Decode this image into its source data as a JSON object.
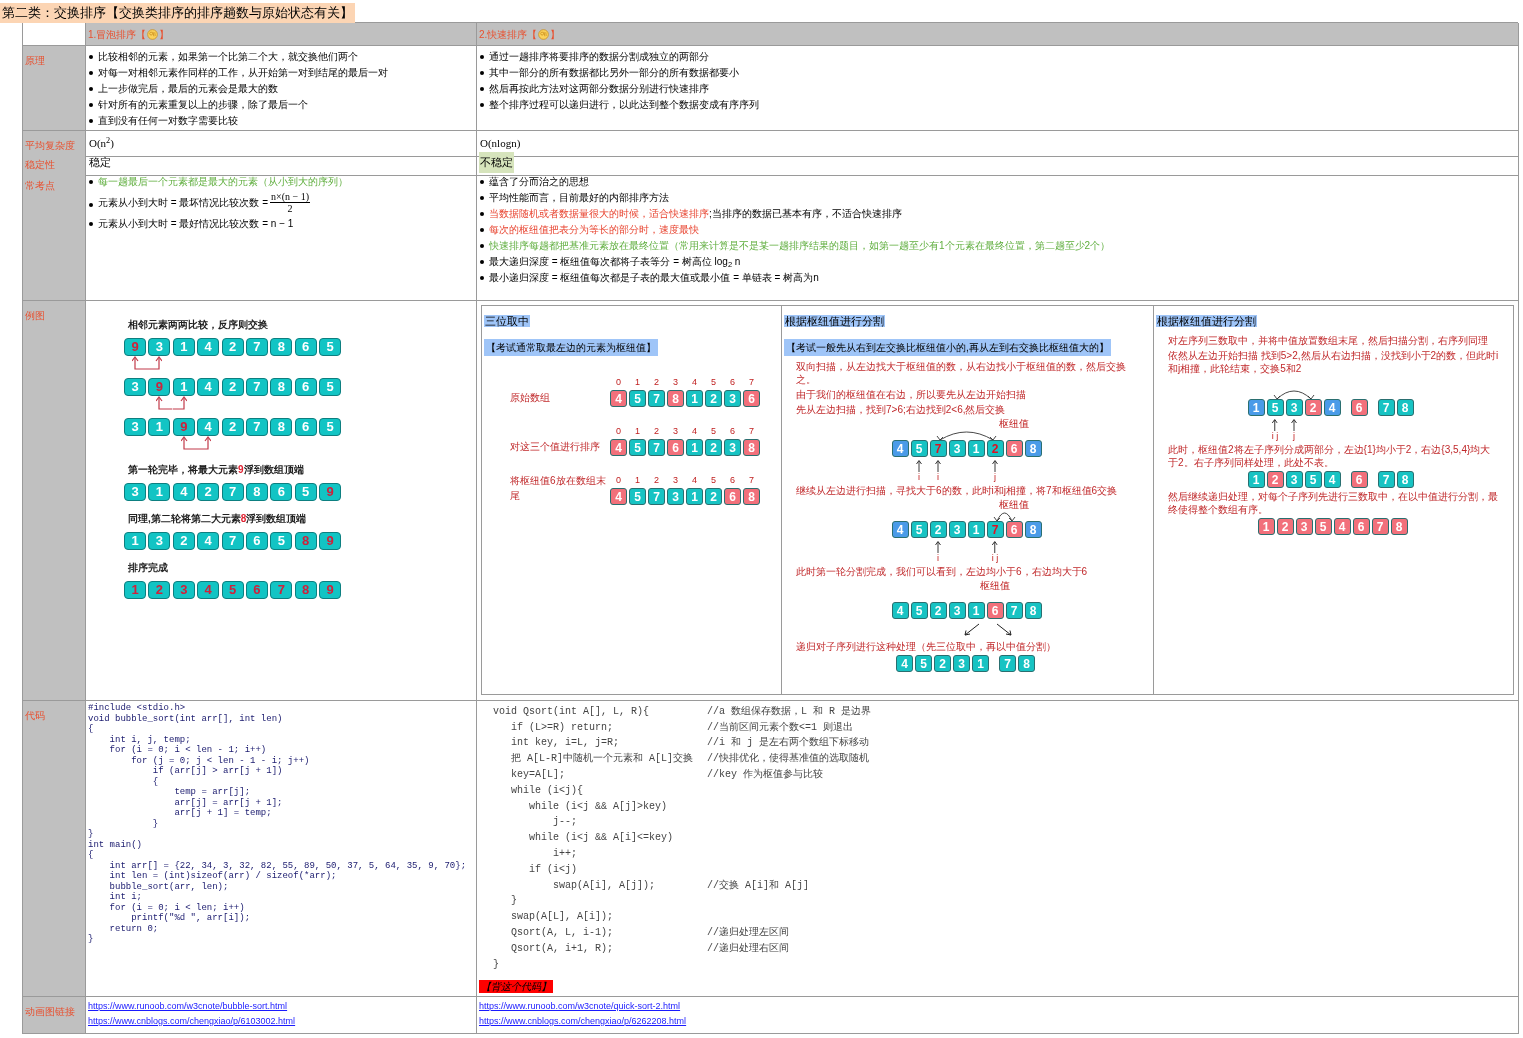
{
  "title": "第二类：交换排序【交换类排序的排序趟数与原始状态有关】",
  "columns": [
    {
      "prefix": "1.冒泡排序【",
      "suffix": "】"
    },
    {
      "prefix": "2.快速排序【",
      "suffix": "】"
    }
  ],
  "row_labels": [
    "原理",
    "平均复杂度",
    "稳定性",
    "常考点",
    "例图",
    "代码",
    "动画图链接"
  ],
  "principle": [
    [
      "比较相邻的元素，如果第一个比第二个大，就交换他们两个",
      "对每一对相邻元素作同样的工作，从开始第一对到结尾的最后一对",
      "上一步做完后，最后的元素会是最大的数",
      "针对所有的元素重复以上的步骤，除了最后一个",
      "直到没有任何一对数字需要比较"
    ],
    [
      "通过一趟排序将要排序的数据分割成独立的两部分",
      "其中一部分的所有数据都比另外一部分的所有数据都要小",
      "然后再按此方法对这两部分数据分别进行快速排序",
      "整个排序过程可以递归进行，以此达到整个数据变成有序序列"
    ]
  ],
  "complexity": [
    "O(n$^{2}$)",
    "O(nlogn)"
  ],
  "stability": [
    {
      "text": "稳定",
      "highlighted": false
    },
    {
      "text": "不稳定",
      "highlighted": true
    }
  ],
  "key_points": [
    [
      {
        "kind": "text",
        "parts": [
          {
            "text": "每一趟最后一个元素都是最大的元素（从小到大的序列）",
            "kind": "green"
          }
        ]
      },
      {
        "kind": "fraction",
        "text": "元素从小到大时 =  最坏情况比较次数 =",
        "numerator": "n×(n − 1)",
        "denominator": "2"
      },
      {
        "kind": "text",
        "parts": [
          {
            "text": " 元素从小到大时 =  最好情况比较次数 =  n − 1",
            "kind": "plain"
          }
        ]
      }
    ],
    [
      {
        "kind": "text",
        "parts": [
          {
            "text": "蕴含了分而治之的思想",
            "kind": "plain"
          }
        ]
      },
      {
        "kind": "text",
        "parts": [
          {
            "text": "平均性能而言，目前最好的内部排序方法",
            "kind": "plain"
          }
        ]
      },
      {
        "kind": "text",
        "parts": [
          {
            "text": "当数据随机或者数据量很大的时候，适合快速排序",
            "kind": "red"
          },
          {
            "text": ";当排序的数据已基本有序，不适合快速排序",
            "kind": "plain"
          }
        ]
      },
      {
        "kind": "text",
        "parts": [
          {
            "text": "每次的枢纽值把表分为等长的部分时，速度最快",
            "kind": "red"
          }
        ]
      },
      {
        "kind": "text",
        "parts": [
          {
            "text": "快速排序每趟都把基准元素放在最终位置（常用来计算是不是某一趟排序结果的题目，如第一趟至少有1个元素在最终位置，第二趟至少2个）",
            "kind": "green"
          }
        ]
      },
      {
        "kind": "text",
        "parts": [
          {
            "text": " 最大递归深度 =  枢纽值每次都将子表等分 = 树高位 log$_{2}$ n",
            "kind": "plain"
          }
        ]
      },
      {
        "kind": "text",
        "parts": [
          {
            "text": "最小递归深度 = 枢纽值每次都是子表的最大值或最小值 =  单链表 =  树高为n",
            "kind": "plain"
          }
        ]
      }
    ]
  ],
  "bubble_example": [
    {
      "kind": "caption",
      "parts": [
        {
          "text": "相邻元素两两比较，反序则交换",
          "red": false
        }
      ]
    },
    {
      "kind": "array",
      "cells": [
        {
          "v": "9",
          "red": true,
          "arrow": true
        },
        {
          "v": "3",
          "red": false,
          "arrow": true
        },
        {
          "v": "1",
          "red": false,
          "arrow": false
        },
        {
          "v": "4",
          "red": false,
          "arrow": false
        },
        {
          "v": "2",
          "red": false,
          "arrow": false
        },
        {
          "v": "7",
          "red": false,
          "arrow": false
        },
        {
          "v": "8",
          "red": false,
          "arrow": false
        },
        {
          "v": "6",
          "red": false,
          "arrow": false
        },
        {
          "v": "5",
          "red": false,
          "arrow": false
        }
      ]
    },
    {
      "kind": "array",
      "cells": [
        {
          "v": "3",
          "red": false,
          "arrow": false
        },
        {
          "v": "9",
          "red": true,
          "arrow": true
        },
        {
          "v": "1",
          "red": false,
          "arrow": true
        },
        {
          "v": "4",
          "red": false,
          "arrow": false
        },
        {
          "v": "2",
          "red": false,
          "arrow": false
        },
        {
          "v": "7",
          "red": false,
          "arrow": false
        },
        {
          "v": "8",
          "red": false,
          "arrow": false
        },
        {
          "v": "6",
          "red": false,
          "arrow": false
        },
        {
          "v": "5",
          "red": false,
          "arrow": false
        }
      ]
    },
    {
      "kind": "array",
      "cells": [
        {
          "v": "3",
          "red": false,
          "arrow": false
        },
        {
          "v": "1",
          "red": false,
          "arrow": false
        },
        {
          "v": "9",
          "red": true,
          "arrow": true
        },
        {
          "v": "4",
          "red": false,
          "arrow": true
        },
        {
          "v": "2",
          "red": false,
          "arrow": false
        },
        {
          "v": "7",
          "red": false,
          "arrow": false
        },
        {
          "v": "8",
          "red": false,
          "arrow": false
        },
        {
          "v": "6",
          "red": false,
          "arrow": false
        },
        {
          "v": "5",
          "red": false,
          "arrow": false
        }
      ]
    },
    {
      "kind": "caption",
      "parts": [
        {
          "text": "第一轮完毕，将最大元素",
          "red": false
        },
        {
          "text": "9",
          "red": true
        },
        {
          "text": "浮到数组顶端",
          "red": false
        }
      ]
    },
    {
      "kind": "array",
      "cells": [
        {
          "v": "3",
          "red": false,
          "arrow": false
        },
        {
          "v": "1",
          "red": false,
          "arrow": false
        },
        {
          "v": "4",
          "red": false,
          "arrow": false
        },
        {
          "v": "2",
          "red": false,
          "arrow": false
        },
        {
          "v": "7",
          "red": false,
          "arrow": false
        },
        {
          "v": "8",
          "red": false,
          "arrow": false
        },
        {
          "v": "6",
          "red": false,
          "arrow": false
        },
        {
          "v": "5",
          "red": false,
          "arrow": false
        },
        {
          "v": "9",
          "red": true,
          "arrow": false
        }
      ]
    },
    {
      "kind": "caption",
      "parts": [
        {
          "text": "同理,第二轮将第二大元素",
          "red": false
        },
        {
          "text": "8",
          "red": true
        },
        {
          "text": "浮到数组顶端",
          "red": false
        }
      ]
    },
    {
      "kind": "array",
      "cells": [
        {
          "v": "1",
          "red": false,
          "arrow": false
        },
        {
          "v": "3",
          "red": false,
          "arrow": false
        },
        {
          "v": "2",
          "red": false,
          "arrow": false
        },
        {
          "v": "4",
          "red": false,
          "arrow": false
        },
        {
          "v": "7",
          "red": false,
          "arrow": false
        },
        {
          "v": "6",
          "red": false,
          "arrow": false
        },
        {
          "v": "5",
          "red": false,
          "arrow": false
        },
        {
          "v": "8",
          "red": true,
          "arrow": false
        },
        {
          "v": "9",
          "red": true,
          "arrow": false
        }
      ]
    },
    {
      "kind": "caption",
      "parts": [
        {
          "text": "排序完成",
          "red": false
        }
      ]
    },
    {
      "kind": "array",
      "cells": [
        {
          "v": "1",
          "red": true,
          "arrow": false
        },
        {
          "v": "2",
          "red": true,
          "arrow": false
        },
        {
          "v": "3",
          "red": true,
          "arrow": false
        },
        {
          "v": "4",
          "red": true,
          "arrow": false
        },
        {
          "v": "5",
          "red": true,
          "arrow": false
        },
        {
          "v": "6",
          "red": true,
          "arrow": false
        },
        {
          "v": "7",
          "red": true,
          "arrow": false
        },
        {
          "v": "8",
          "red": true,
          "arrow": false
        },
        {
          "v": "9",
          "red": true,
          "arrow": false
        }
      ]
    }
  ],
  "quick_panels": [
    {
      "title": "三位取中",
      "items": [
        {
          "kind": "subtitle",
          "text": "【考试通常取最左边的元素为枢纽值】"
        },
        {
          "kind": "array",
          "label": "原始数组",
          "groups": [
            [
              {
                "v": "4",
                "color": "#f2707b",
                "red": false,
                "arc": false,
                "index": "0"
              },
              {
                "v": "5",
                "color": "#17c3c3",
                "red": false,
                "arc": false,
                "index": "1"
              },
              {
                "v": "7",
                "color": "#17c3c3",
                "red": false,
                "arc": false,
                "index": "2"
              },
              {
                "v": "8",
                "color": "#f2707b",
                "red": false,
                "arc": false,
                "index": "3"
              },
              {
                "v": "1",
                "color": "#17c3c3",
                "red": false,
                "arc": false,
                "index": "4"
              },
              {
                "v": "2",
                "color": "#17c3c3",
                "red": false,
                "arc": false,
                "index": "5"
              },
              {
                "v": "3",
                "color": "#17c3c3",
                "red": false,
                "arc": false,
                "index": "6"
              },
              {
                "v": "6",
                "color": "#f2707b",
                "red": false,
                "arc": false,
                "index": "7"
              }
            ]
          ]
        },
        {
          "kind": "array",
          "label": "对这三个值进行排序",
          "groups": [
            [
              {
                "v": "4",
                "color": "#f2707b",
                "red": false,
                "arc": false,
                "index": "0"
              },
              {
                "v": "5",
                "color": "#17c3c3",
                "red": false,
                "arc": false,
                "index": "1"
              },
              {
                "v": "7",
                "color": "#17c3c3",
                "red": false,
                "arc": false,
                "index": "2"
              },
              {
                "v": "6",
                "color": "#f2707b",
                "red": false,
                "arc": false,
                "index": "3"
              },
              {
                "v": "1",
                "color": "#17c3c3",
                "red": false,
                "arc": false,
                "index": "4"
              },
              {
                "v": "2",
                "color": "#17c3c3",
                "red": false,
                "arc": false,
                "index": "5"
              },
              {
                "v": "3",
                "color": "#17c3c3",
                "red": false,
                "arc": false,
                "index": "6"
              },
              {
                "v": "8",
                "color": "#f2707b",
                "red": false,
                "arc": false,
                "index": "7"
              }
            ]
          ]
        },
        {
          "kind": "array",
          "label": "将枢纽值6放在数组末尾",
          "groups": [
            [
              {
                "v": "4",
                "color": "#f2707b",
                "red": false,
                "arc": false,
                "index": "0"
              },
              {
                "v": "5",
                "color": "#17c3c3",
                "red": false,
                "arc": false,
                "index": "1"
              },
              {
                "v": "7",
                "color": "#17c3c3",
                "red": false,
                "arc": false,
                "index": "2"
              },
              {
                "v": "3",
                "color": "#17c3c3",
                "red": false,
                "arc": false,
                "index": "3"
              },
              {
                "v": "1",
                "color": "#17c3c3",
                "red": false,
                "arc": false,
                "index": "4"
              },
              {
                "v": "2",
                "color": "#17c3c3",
                "red": false,
                "arc": false,
                "index": "5"
              },
              {
                "v": "6",
                "color": "#f2707b",
                "red": false,
                "arc": false,
                "index": "6"
              },
              {
                "v": "8",
                "color": "#f2707b",
                "red": false,
                "arc": false,
                "index": "7"
              }
            ]
          ]
        }
      ]
    },
    {
      "title": "根据枢纽值进行分割",
      "items": [
        {
          "kind": "subtitle",
          "text": "【考试一般先从右到左交换比枢纽值小的,再从左到右交换比枢纽值大的】"
        },
        {
          "kind": "note",
          "text": "双向扫描，从左边找大于枢纽值的数，从右边找小于枢纽值的数，然后交换之。"
        },
        {
          "kind": "note",
          "text": "由于我们的枢纽值在右边，所以要先从左边开始扫描"
        },
        {
          "kind": "note",
          "text": "先从左边扫描，找到7>6;右边找到2<6,然后交换"
        },
        {
          "kind": "array",
          "groups": [
            [
              {
                "v": "4",
                "color": "#4a9be8",
                "red": false,
                "arc": false
              },
              {
                "v": "5",
                "color": "#17c3c3",
                "red": false,
                "arc": false,
                "pointer": "i"
              },
              {
                "v": "7",
                "color": "#17c3c3",
                "red": true,
                "arc": true,
                "pointer": "i"
              },
              {
                "v": "3",
                "color": "#17c3c3",
                "red": false,
                "arc": false
              },
              {
                "v": "1",
                "color": "#17c3c3",
                "red": false,
                "arc": false
              },
              {
                "v": "2",
                "color": "#17c3c3",
                "red": true,
                "arc": true,
                "pointer": "j"
              },
              {
                "v": "6",
                "color": "#f2707b",
                "red": false,
                "arc": false,
                "tag": "枢纽值"
              },
              {
                "v": "8",
                "color": "#4a9be8",
                "red": false,
                "arc": false
              }
            ]
          ]
        },
        {
          "kind": "note",
          "text": "继续从左边进行扫描，寻找大于6的数，此时i和j相撞，将7和枢纽值6交换"
        },
        {
          "kind": "array",
          "groups": [
            [
              {
                "v": "4",
                "color": "#4a9be8",
                "red": false,
                "arc": false
              },
              {
                "v": "5",
                "color": "#17c3c3",
                "red": false,
                "arc": false
              },
              {
                "v": "2",
                "color": "#17c3c3",
                "red": false,
                "arc": false,
                "pointer": "i"
              },
              {
                "v": "3",
                "color": "#17c3c3",
                "red": false,
                "arc": false
              },
              {
                "v": "1",
                "color": "#17c3c3",
                "red": false,
                "arc": false
              },
              {
                "v": "7",
                "color": "#17c3c3",
                "red": true,
                "arc": true,
                "pointer": "i j"
              },
              {
                "v": "6",
                "color": "#f2707b",
                "red": false,
                "arc": true,
                "tag": "枢纽值"
              },
              {
                "v": "8",
                "color": "#4a9be8",
                "red": false,
                "arc": false
              }
            ]
          ]
        },
        {
          "kind": "note",
          "text": "此时第一轮分割完成，我们可以看到，左边均小于6，右边均大于6"
        },
        {
          "kind": "array",
          "groups": [
            [
              {
                "v": "4",
                "color": "#17c3c3",
                "red": false,
                "arc": false
              },
              {
                "v": "5",
                "color": "#17c3c3",
                "red": false,
                "arc": false
              },
              {
                "v": "2",
                "color": "#17c3c3",
                "red": false,
                "arc": false
              },
              {
                "v": "3",
                "color": "#17c3c3",
                "red": false,
                "arc": false
              },
              {
                "v": "1",
                "color": "#17c3c3",
                "red": false,
                "arc": false
              },
              {
                "v": "6",
                "color": "#f2707b",
                "red": false,
                "arc": false,
                "tag": "枢纽值"
              },
              {
                "v": "7",
                "color": "#17c3c3",
                "red": false,
                "arc": false
              },
              {
                "v": "8",
                "color": "#17c3c3",
                "red": false,
                "arc": false
              }
            ]
          ]
        },
        {
          "kind": "split"
        },
        {
          "kind": "note",
          "text": "递归对子序列进行这种处理（先三位取中，再以中值分割）"
        },
        {
          "kind": "array",
          "groups": [
            [
              {
                "v": "4",
                "color": "#17c3c3",
                "red": false,
                "arc": false
              },
              {
                "v": "5",
                "color": "#17c3c3",
                "red": false,
                "arc": false
              },
              {
                "v": "2",
                "color": "#17c3c3",
                "red": false,
                "arc": false
              },
              {
                "v": "3",
                "color": "#17c3c3",
                "red": false,
                "arc": false
              },
              {
                "v": "1",
                "color": "#17c3c3",
                "red": false,
                "arc": false
              }
            ],
            [
              {
                "v": "7",
                "color": "#17c3c3",
                "red": false,
                "arc": false
              },
              {
                "v": "8",
                "color": "#17c3c3",
                "red": false,
                "arc": false
              }
            ]
          ]
        }
      ]
    },
    {
      "title": "根据枢纽值进行分割",
      "items": [
        {
          "kind": "note",
          "text": "对左序列三数取中，并将中值放置数组末尾，然后扫描分割，右序列同理"
        },
        {
          "kind": "note",
          "text": "依然从左边开始扫描 找到5>2,然后从右边扫描，没找到小于2的数，但此时i和j相撞，此轮结束，交换5和2"
        },
        {
          "kind": "array",
          "groups": [
            [
              {
                "v": "1",
                "color": "#4a9be8",
                "red": false,
                "arc": false
              },
              {
                "v": "5",
                "color": "#17c3c3",
                "red": false,
                "arc": true,
                "pointer": "i j"
              },
              {
                "v": "3",
                "color": "#17c3c3",
                "red": false,
                "arc": false,
                "pointer": "j"
              },
              {
                "v": "2",
                "color": "#f2707b",
                "red": false,
                "arc": true
              },
              {
                "v": "4",
                "color": "#4a9be8",
                "red": false,
                "arc": false
              }
            ],
            [
              {
                "v": "6",
                "color": "#f2707b",
                "red": false,
                "arc": false
              }
            ],
            [
              {
                "v": "7",
                "color": "#17c3c3",
                "red": false,
                "arc": false
              },
              {
                "v": "8",
                "color": "#17c3c3",
                "red": false,
                "arc": false
              }
            ]
          ]
        },
        {
          "kind": "note",
          "text": "此时，枢纽值2将左子序列分成两部分，左边{1}均小于2，右边{3,5,4}均大于2。右子序列同样处理，此处不表。"
        },
        {
          "kind": "array",
          "groups": [
            [
              {
                "v": "1",
                "color": "#17c3c3",
                "red": false,
                "arc": false
              },
              {
                "v": "2",
                "color": "#f2707b",
                "red": false,
                "arc": false
              },
              {
                "v": "3",
                "color": "#17c3c3",
                "red": false,
                "arc": false
              },
              {
                "v": "5",
                "color": "#17c3c3",
                "red": false,
                "arc": false
              },
              {
                "v": "4",
                "color": "#17c3c3",
                "red": false,
                "arc": false
              }
            ],
            [
              {
                "v": "6",
                "color": "#f2707b",
                "red": false,
                "arc": false
              }
            ],
            [
              {
                "v": "7",
                "color": "#17c3c3",
                "red": false,
                "arc": false
              },
              {
                "v": "8",
                "color": "#17c3c3",
                "red": false,
                "arc": false
              }
            ]
          ]
        },
        {
          "kind": "note",
          "text": "然后继续递归处理，对每个子序列先进行三数取中，在以中值进行分割，最终使得整个数组有序。"
        },
        {
          "kind": "array",
          "groups": [
            [
              {
                "v": "1",
                "color": "#f2707b",
                "red": false,
                "arc": false
              },
              {
                "v": "2",
                "color": "#f2707b",
                "red": false,
                "arc": false
              },
              {
                "v": "3",
                "color": "#f2707b",
                "red": false,
                "arc": false
              },
              {
                "v": "5",
                "color": "#f2707b",
                "red": false,
                "arc": false
              },
              {
                "v": "4",
                "color": "#f2707b",
                "red": false,
                "arc": false
              },
              {
                "v": "6",
                "color": "#f2707b",
                "red": false,
                "arc": false
              },
              {
                "v": "7",
                "color": "#f2707b",
                "red": false,
                "arc": false
              },
              {
                "v": "8",
                "color": "#f2707b",
                "red": false,
                "arc": false
              }
            ]
          ]
        }
      ]
    }
  ],
  "bubble_code": [
    "#include <stdio.h>",
    "void bubble_sort(int arr[], int len)",
    "{",
    "    int i, j, temp;",
    "    for (i = 0; i < len - 1; i++)",
    "        for (j = 0; j < len - 1 - i; j++)",
    "            if (arr[j] > arr[j + 1])",
    "            {",
    "                temp = arr[j];",
    "                arr[j] = arr[j + 1];",
    "                arr[j + 1] = temp;",
    "            }",
    "}",
    "int main()",
    "{",
    "    int arr[] = {22, 34, 3, 32, 82, 55, 89, 50, 37, 5, 64, 35, 9, 70};",
    "    int len = (int)sizeof(arr) / sizeof(*arr);",
    "    bubble_sort(arr, len);",
    "    int i;",
    "    for (i = 0; i < len; i++)",
    "        printf(\"%d \", arr[i]);",
    "    return 0;",
    "}"
  ],
  "quick_code": [
    {
      "code": "void Qsort(int A[], L, R){",
      "comment": "//a 数组保存数据，L 和 R 是边界"
    },
    {
      "code": "   if (L>=R) return;",
      "comment": "//当前区间元素个数<=1 则退出"
    },
    {
      "code": "   int key, i=L, j=R;",
      "comment": "//i 和 j 是左右两个数组下标移动"
    },
    {
      "code": "   把 A[L-R]中随机一个元素和 A[L]交换",
      "comment": "//快排优化，使得基准值的选取随机"
    },
    {
      "code": "   key=A[L];",
      "comment": "//key 作为枢值参与比较"
    },
    {
      "code": "   while (i<j){"
    },
    {
      "code": "      while (i<j && A[j]>key)"
    },
    {
      "code": "          j--;"
    },
    {
      "code": "      while (i<j && A[i]<=key)"
    },
    {
      "code": "          i++;"
    },
    {
      "code": "      if (i<j)"
    },
    {
      "code": "          swap(A[i], A[j]);",
      "comment": "//交换 A[i]和 A[j]"
    },
    {
      "code": "   }"
    },
    {
      "code": "   swap(A[L], A[i]);"
    },
    {
      "code": "   Qsort(A, L, i-1);",
      "comment": "//递归处理左区间"
    },
    {
      "code": "   Qsort(A, i+1, R);",
      "comment": "//递归处理右区间"
    },
    {
      "code": "}"
    }
  ],
  "quick_code_badge": "【背这个代码】",
  "links": [
    [
      "https://www.runoob.com/w3cnote/bubble-sort.html",
      "https://www.cnblogs.com/chengxiao/p/6103002.html"
    ],
    [
      "https://www.runoob.com/w3cnote/quick-sort-2.html",
      "https://www.cnblogs.com/chengxiao/p/6262208.html"
    ]
  ]
}
